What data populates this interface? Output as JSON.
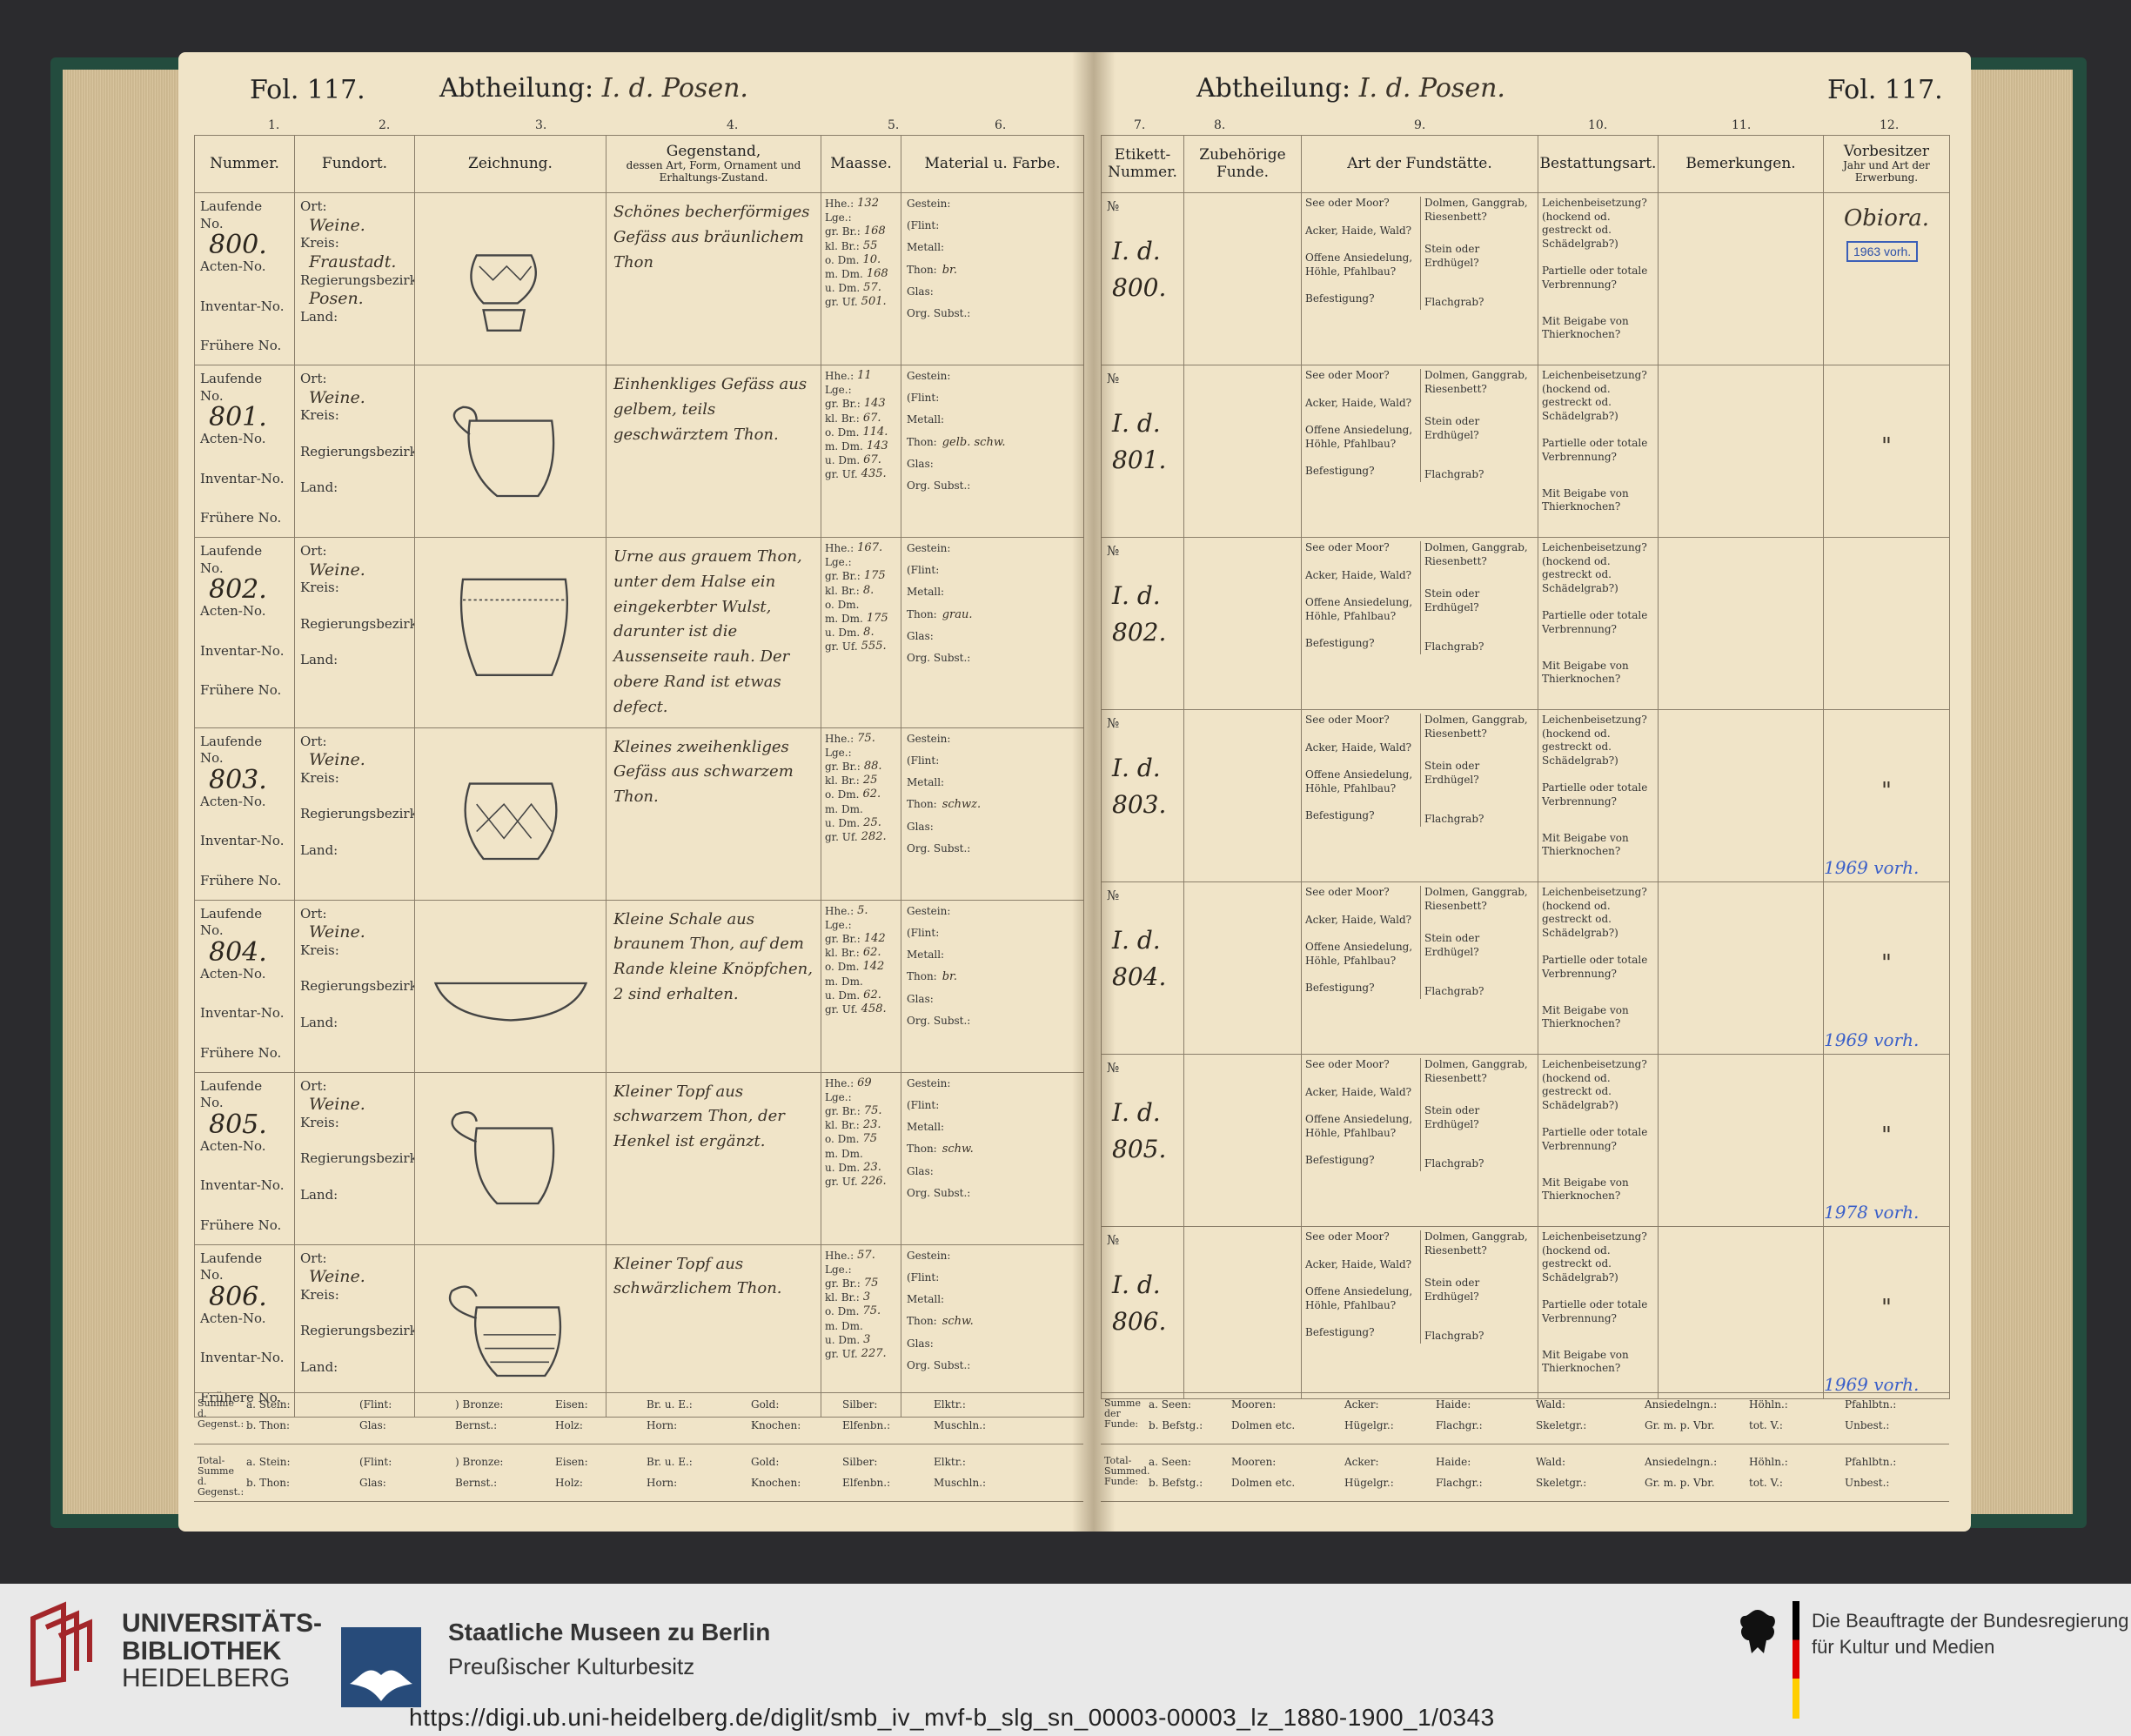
{
  "header": {
    "fol_left": "Fol. 117.",
    "fol_right": "Fol. 117.",
    "abtheilung_label": "Abtheilung:",
    "abtheilung_value": "I. d. Posen."
  },
  "column_numbers_left": [
    "1.",
    "2.",
    "3.",
    "4.",
    "5.",
    "6."
  ],
  "column_numbers_right": [
    "7.",
    "8.",
    "9.",
    "10.",
    "11.",
    "12."
  ],
  "columns_left": {
    "nummer": "Nummer.",
    "fundort": "Fundort.",
    "zeichnung": "Zeichnung.",
    "gegenstand": "Gegenstand,",
    "gegenstand_sub": "dessen Art, Form, Ornament und Erhaltungs-Zustand.",
    "maasse": "Maasse.",
    "material": "Material u. Farbe."
  },
  "columns_right": {
    "etikett": "Etikett-Nummer.",
    "zubehoerige": "Zubehörige Funde.",
    "art": "Art der Fundstätte.",
    "bestattung": "Bestattungsart.",
    "bemerkungen": "Bemerkungen.",
    "vorbesitzer": "Vorbesitzer",
    "vorbesitzer_sub": "Jahr und Art der Erwerbung."
  },
  "labels": {
    "laufende": "Laufende No.",
    "acten": "Acten-No.",
    "inventar": "Inventar-No.",
    "fruehere": "Frühere No.",
    "ort": "Ort:",
    "kreis": "Kreis:",
    "regbez": "Regierungsbezirk:",
    "land": "Land:",
    "lf": "№",
    "see": "See oder Moor?",
    "acker": "Acker, Haide, Wald?",
    "offene": "Offene Ansiedelung, Höhle, Pfahlbau?",
    "befestigung": "Befestigung?",
    "dolmen": "Dolmen, Ganggrab, Riesenbett?",
    "stein": "Stein oder Erdhügel?",
    "flachgrab": "Flachgrab?",
    "leichen": "Leichenbeisetzung? (hockend od. gestreckt od. Schädelgrab?)",
    "partielle": "Partielle oder totale Verbrennung?",
    "beigabe": "Mit Beigabe von Thierknochen?"
  },
  "measure_labels": [
    "Hhe.:",
    "Lge.:",
    "gr. Br.:",
    "kl. Br.:",
    "o. Dm.",
    "m. Dm.",
    "u. Dm.",
    "gr. Uf."
  ],
  "material_labels": [
    "Gestein:",
    "(Flint:",
    "Metall:",
    "Thon:",
    "Glas:",
    "Org. Subst.:"
  ],
  "rows": [
    {
      "no": "800.",
      "ort": "Weine.",
      "kreis": "Fraustadt.",
      "regbez": "Posen.",
      "desc": "Schönes becherförmiges Gefäss aus bräunlichem Thon",
      "measures": [
        "132",
        "",
        "168",
        "55",
        "10.",
        "168",
        "57.",
        "501."
      ],
      "thon": "br.",
      "etikett": "I. d. 800.",
      "vorbesitzer": "Obiora.",
      "stamp": "1963 vorh.",
      "note": ""
    },
    {
      "no": "801.",
      "ort": "Weine.",
      "kreis": "",
      "regbez": "",
      "desc": "Einhenkliges Gefäss aus gelbem, teils geschwärztem Thon.",
      "measures": [
        "11",
        "",
        "143",
        "67.",
        "114.",
        "143",
        "67.",
        "435."
      ],
      "thon": "gelb. schw.",
      "etikett": "I. d. 801.",
      "vorbesitzer": "\"",
      "stamp": "",
      "note": ""
    },
    {
      "no": "802.",
      "ort": "Weine.",
      "kreis": "",
      "regbez": "",
      "desc": "Urne aus grauem Thon, unter dem Halse ein eingekerbter Wulst, darunter ist die Aussenseite rauh. Der obere Rand ist etwas defect.",
      "measures": [
        "167.",
        "",
        "175",
        "8.",
        "",
        "175",
        "8.",
        "555."
      ],
      "thon": "grau.",
      "etikett": "I. d. 802.",
      "vorbesitzer": "",
      "stamp": "",
      "note": ""
    },
    {
      "no": "803.",
      "ort": "Weine.",
      "kreis": "",
      "regbez": "",
      "desc": "Kleines zweihenkliges Gefäss aus schwarzem Thon.",
      "measures": [
        "75.",
        "",
        "88.",
        "25",
        "62.",
        "",
        "25.",
        "282."
      ],
      "thon": "schwz.",
      "etikett": "I. d. 803.",
      "vorbesitzer": "\"",
      "stamp": "",
      "note": "1969 vorh."
    },
    {
      "no": "804.",
      "ort": "Weine.",
      "kreis": "",
      "regbez": "",
      "desc": "Kleine Schale aus braunem Thon, auf dem Rande kleine Knöpfchen, 2 sind erhalten.",
      "measures": [
        "5.",
        "",
        "142",
        "62.",
        "142",
        "",
        "62.",
        "458."
      ],
      "thon": "br.",
      "etikett": "I. d. 804.",
      "vorbesitzer": "\"",
      "stamp": "",
      "note": "1969 vorh."
    },
    {
      "no": "805.",
      "ort": "Weine.",
      "kreis": "",
      "regbez": "",
      "desc": "Kleiner Topf aus schwarzem Thon, der Henkel ist ergänzt.",
      "measures": [
        "69",
        "",
        "75.",
        "23.",
        "75",
        "",
        "23.",
        "226."
      ],
      "thon": "schw.",
      "etikett": "I. d. 805.",
      "vorbesitzer": "\"",
      "stamp": "",
      "note": "1978 vorh."
    },
    {
      "no": "806.",
      "ort": "Weine.",
      "kreis": "",
      "regbez": "",
      "desc": "Kleiner Topf aus schwärzlichem Thon.",
      "measures": [
        "57.",
        "",
        "75",
        "3",
        "75.",
        "",
        "3",
        "227."
      ],
      "thon": "schw.",
      "etikett": "I. d. 806.",
      "vorbesitzer": "\"",
      "stamp": "",
      "note": "1969 vorh."
    }
  ],
  "summary_left": {
    "label1": "Summe d. Gegenst.:",
    "label2": "Total-Summe d. Gegenst.:",
    "row_a": [
      "a. Stein:",
      "(Flint:",
      ") Bronze:",
      "Eisen:",
      "Br. u. E.:",
      "Gold:",
      "Silber:",
      "Elktr.:"
    ],
    "row_b": [
      "b. Thon:",
      "Glas:",
      "Bernst.:",
      "Holz:",
      "Horn:",
      "Knochen:",
      "Elfenbn.:",
      "Muschln.:"
    ]
  },
  "summary_right": {
    "label1": "Summe der Funde:",
    "label2": "Total-Summed. Funde:",
    "row_a": [
      "a. Seen:",
      "Mooren:",
      "Acker:",
      "Haide:",
      "Wald:",
      "Ansiedelngn.:",
      "Höhln.:",
      "Pfahlbtn.:"
    ],
    "row_b": [
      "b. Befstg.:",
      "Dolmen etc.",
      "Hügelgr.:",
      "Flachgr.:",
      "Skeletgr.:",
      "Gr. m. p. Vbr.",
      "tot. V.:",
      "Unbest.:"
    ]
  },
  "footer": {
    "ub_line1": "UNIVERSITÄTS-",
    "ub_line2": "BIBLIOTHEK",
    "ub_line3": "HEIDELBERG",
    "smb_line1": "Staatliche Museen zu Berlin",
    "smb_line2": "Preußischer Kulturbesitz",
    "bkm_line1": "Die Beauftragte der Bundesregierung",
    "bkm_line2": "für Kultur und Medien",
    "url": "https://digi.ub.uni-heidelberg.de/diglit/smb_iv_mvf-b_slg_sn_00003-00003_lz_1880-1900_1/0343"
  }
}
